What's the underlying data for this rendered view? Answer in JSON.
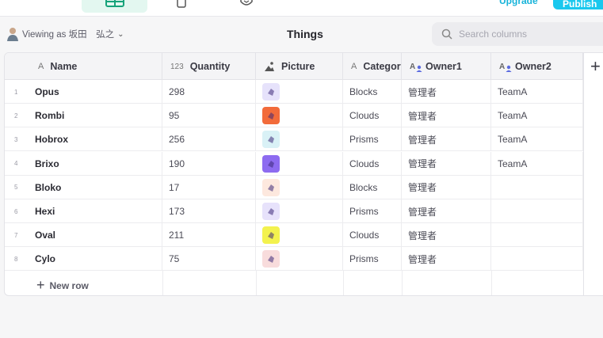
{
  "header": {
    "title": "Things",
    "viewing_as": "Viewing as 坂田　弘之",
    "search_placeholder": "Search columns",
    "upgrade_label": "Upgrade",
    "publish_label": "Publish"
  },
  "columns": [
    {
      "key": "name",
      "label": "Name",
      "type_icon": "A"
    },
    {
      "key": "quantity",
      "label": "Quantity",
      "type_icon": "123"
    },
    {
      "key": "picture",
      "label": "Picture",
      "type_icon": "image-icon"
    },
    {
      "key": "category",
      "label": "Category",
      "type_icon": "A"
    },
    {
      "key": "owner1",
      "label": "Owner1",
      "type_icon": "user-text-icon"
    },
    {
      "key": "owner2",
      "label": "Owner2",
      "type_icon": "user-text-icon"
    }
  ],
  "rows": [
    {
      "idx": "1",
      "name": "Opus",
      "quantity": "298",
      "picture_color": "#e6e2fb",
      "category": "Blocks",
      "owner1": "管理者",
      "owner2": "TeamA"
    },
    {
      "idx": "2",
      "name": "Rombi",
      "quantity": "95",
      "picture_color": "#f26b3a",
      "category": "Clouds",
      "owner1": "管理者",
      "owner2": "TeamA"
    },
    {
      "idx": "3",
      "name": "Hobrox",
      "quantity": "256",
      "picture_color": "#d9f1f6",
      "category": "Prisms",
      "owner1": "管理者",
      "owner2": "TeamA"
    },
    {
      "idx": "4",
      "name": "Brixo",
      "quantity": "190",
      "picture_color": "#8d6bf0",
      "category": "Clouds",
      "owner1": "管理者",
      "owner2": "TeamA"
    },
    {
      "idx": "5",
      "name": "Bloko",
      "quantity": "17",
      "picture_color": "#fde8de",
      "category": "Blocks",
      "owner1": "管理者",
      "owner2": ""
    },
    {
      "idx": "6",
      "name": "Hexi",
      "quantity": "173",
      "picture_color": "#e7e2fb",
      "category": "Prisms",
      "owner1": "管理者",
      "owner2": ""
    },
    {
      "idx": "7",
      "name": "Oval",
      "quantity": "211",
      "picture_color": "#f3f24e",
      "category": "Clouds",
      "owner1": "管理者",
      "owner2": ""
    },
    {
      "idx": "8",
      "name": "Cylo",
      "quantity": "75",
      "picture_color": "#f8dcdc",
      "category": "Prisms",
      "owner1": "管理者",
      "owner2": ""
    }
  ],
  "new_row_label": "New row",
  "colors": {
    "accent": "#1ac8ee",
    "active_tab": "#e3f7f0",
    "grid_border": "#e3e3e8"
  }
}
